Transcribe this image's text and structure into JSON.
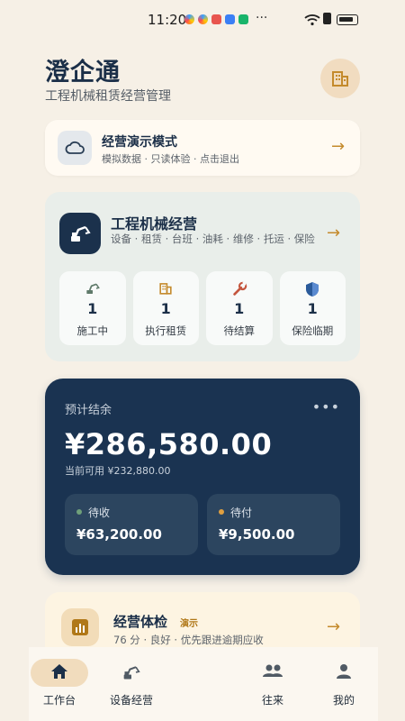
{
  "status_bar": {
    "time": "11:20",
    "more": "···"
  },
  "header": {
    "title": "澄企通",
    "subtitle": "工程机械租赁经营管理"
  },
  "demo": {
    "title": "经营演示模式",
    "subtitle": "模拟数据 · 只读体验 · 点击退出"
  },
  "machinery": {
    "title": "工程机械经营",
    "tags": "设备 · 租赁 · 台班 · 油耗 · 维修 · 托运 · 保险",
    "stats": [
      {
        "icon": "excavator-icon",
        "value": "1",
        "label": "施工中"
      },
      {
        "icon": "building-icon",
        "value": "1",
        "label": "执行租赁"
      },
      {
        "icon": "wrench-icon",
        "value": "1",
        "label": "待结算"
      },
      {
        "icon": "shield-icon",
        "value": "1",
        "label": "保险临期"
      }
    ]
  },
  "balance": {
    "label": "预计结余",
    "more": "•••",
    "amount": "¥286,580.00",
    "available": "当前可用 ¥232,880.00",
    "receivable": {
      "label": "待收",
      "value": "¥63,200.00",
      "dot_color": "#6fa07a"
    },
    "payable": {
      "label": "待付",
      "value": "¥9,500.00",
      "dot_color": "#e0a040"
    }
  },
  "health": {
    "title": "经营体检",
    "badge": "演示",
    "subtitle": "76 分 · 良好 · 优先跟进逾期应收"
  },
  "nav": [
    {
      "label": "工作台",
      "icon": "home-icon",
      "active": true
    },
    {
      "label": "设备经营",
      "icon": "excavator-icon",
      "active": false
    },
    {
      "label": "往来",
      "icon": "people-icon",
      "active": false
    },
    {
      "label": "我的",
      "icon": "person-icon",
      "active": false
    }
  ],
  "colors": {
    "primary": "#1a3351",
    "accent": "#c48a2c",
    "background": "#f6f0e6"
  }
}
